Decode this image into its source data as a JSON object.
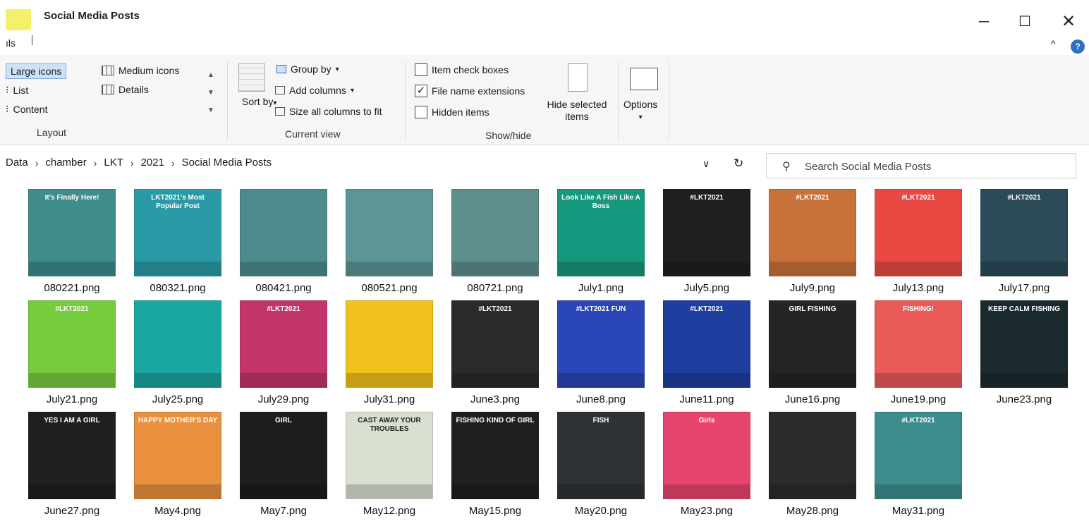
{
  "window": {
    "title": "Social Media Posts",
    "controls": {
      "minimize": "─",
      "maximize": "☐",
      "close": "✕"
    }
  },
  "tabs": {
    "tools": "ıls",
    "collapse": "^",
    "help": "?"
  },
  "ribbon": {
    "layout": {
      "label": "Layout",
      "items": [
        "Large icons",
        "Medium icons",
        "List",
        "Details",
        "Content"
      ]
    },
    "current_view": {
      "label": "Current view",
      "sort_by": "Sort by",
      "group_by": "Group by",
      "add_columns": "Add columns",
      "size_columns": "Size all columns to fit"
    },
    "show_hide": {
      "label": "Show/hide",
      "item_check_boxes": {
        "label": "Item check boxes",
        "checked": false
      },
      "file_name_extensions": {
        "label": "File name extensions",
        "checked": true
      },
      "hidden_items": {
        "label": "Hidden items",
        "checked": false
      },
      "hide_selected": "Hide selected items"
    },
    "options": "Options"
  },
  "address": {
    "crumbs": [
      "Data",
      "chamber",
      "LKT",
      "2021",
      "Social Media Posts"
    ],
    "refresh_icon": "↻",
    "dropdown_icon": "∨"
  },
  "search": {
    "placeholder": "Search Social Media Posts"
  },
  "files": [
    {
      "name": "080221.png",
      "color": "#3f8c8c",
      "text": "It's Finally Here!"
    },
    {
      "name": "080321.png",
      "color": "#2a9ba6",
      "text": "LKT2021's Most Popular Post"
    },
    {
      "name": "080421.png",
      "color": "#4e8b8c",
      "text": ""
    },
    {
      "name": "080521.png",
      "color": "#5c9595",
      "text": ""
    },
    {
      "name": "080721.png",
      "color": "#5e8e8b",
      "text": ""
    },
    {
      "name": "July1.png",
      "color": "#16987e",
      "text": "Look Like A Fish Like A Boss"
    },
    {
      "name": "July5.png",
      "color": "#1f1f1f",
      "text": "#LKT2021"
    },
    {
      "name": "July9.png",
      "color": "#c8723a",
      "text": "#LKT2021"
    },
    {
      "name": "July13.png",
      "color": "#e84a43",
      "text": "#LKT2021"
    },
    {
      "name": "July17.png",
      "color": "#2a4b57",
      "text": "#LKT2021"
    },
    {
      "name": "July21.png",
      "color": "#77cc3d",
      "text": "#LKT2021"
    },
    {
      "name": "July25.png",
      "color": "#1aa7a2",
      "text": ""
    },
    {
      "name": "July29.png",
      "color": "#c2356b",
      "text": "#LKT2021"
    },
    {
      "name": "July31.png",
      "color": "#f2c21c",
      "text": ""
    },
    {
      "name": "June3.png",
      "color": "#2a2a2a",
      "text": "#LKT2021"
    },
    {
      "name": "June8.png",
      "color": "#2a46b8",
      "text": "#LKT2021 FUN"
    },
    {
      "name": "June11.png",
      "color": "#1e3fa0",
      "text": "#LKT2021"
    },
    {
      "name": "June16.png",
      "color": "#252525",
      "text": "GIRL FISHING"
    },
    {
      "name": "June19.png",
      "color": "#ea5a58",
      "text": "FISHING!"
    },
    {
      "name": "June23.png",
      "color": "#1b2a2e",
      "text": "KEEP CALM FISHING"
    },
    {
      "name": "June27.png",
      "color": "#1f1f1f",
      "text": "YES I AM A GIRL"
    },
    {
      "name": "May4.png",
      "color": "#e8903d",
      "text": "HAPPY MOTHER'S DAY"
    },
    {
      "name": "May7.png",
      "color": "#1d1d1d",
      "text": "GIRL"
    },
    {
      "name": "May12.png",
      "color": "#d8e0d2",
      "text": "CAST AWAY YOUR TROUBLES"
    },
    {
      "name": "May15.png",
      "color": "#1f1f1f",
      "text": "FISHING KIND OF GIRL"
    },
    {
      "name": "May20.png",
      "color": "#2d3236",
      "text": "FISH"
    },
    {
      "name": "May23.png",
      "color": "#e8456e",
      "text": "Girls"
    },
    {
      "name": "May28.png",
      "color": "#2b2b2b",
      "text": ""
    },
    {
      "name": "May31.png",
      "color": "#3d8d8e",
      "text": "#LKT2021"
    }
  ]
}
